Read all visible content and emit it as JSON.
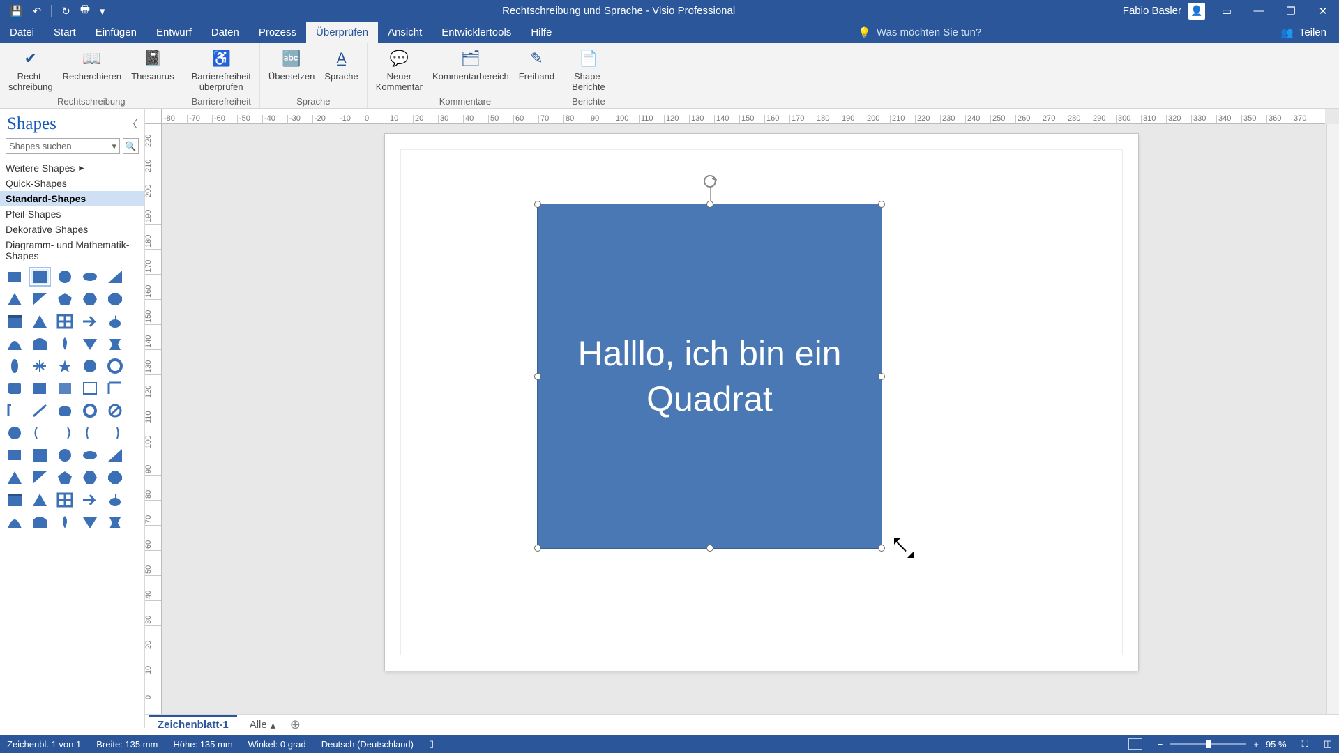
{
  "title": "Rechtschreibung und Sprache  -  Visio Professional",
  "user_name": "Fabio Basler",
  "qat": {
    "save": "💾",
    "undo": "↶",
    "redo": "↻",
    "print": "🖶"
  },
  "tabs": [
    "Datei",
    "Start",
    "Einfügen",
    "Entwurf",
    "Daten",
    "Prozess",
    "Überprüfen",
    "Ansicht",
    "Entwicklertools",
    "Hilfe"
  ],
  "active_tab_index": 6,
  "tell_me": "Was möchten Sie tun?",
  "share": "Teilen",
  "ribbon_groups": [
    {
      "label": "Rechtschreibung",
      "buttons": [
        {
          "id": "spelling",
          "label": "Recht-\nschreibung",
          "glyph": "✔"
        },
        {
          "id": "research",
          "label": "Recherchieren",
          "glyph": "📖"
        },
        {
          "id": "thesaurus",
          "label": "Thesaurus",
          "glyph": "📓"
        }
      ]
    },
    {
      "label": "Barrierefreiheit",
      "buttons": [
        {
          "id": "a11y",
          "label": "Barrierefreiheit\nüberprüfen",
          "glyph": "♿"
        }
      ]
    },
    {
      "label": "Sprache",
      "buttons": [
        {
          "id": "translate",
          "label": "Übersetzen",
          "glyph": "🔤"
        },
        {
          "id": "language",
          "label": "Sprache",
          "glyph": "A̲"
        }
      ]
    },
    {
      "label": "Kommentare",
      "buttons": [
        {
          "id": "newcomment",
          "label": "Neuer\nKommentar",
          "glyph": "💬"
        },
        {
          "id": "commentpane",
          "label": "Kommentarbereich",
          "glyph": "🗂"
        },
        {
          "id": "ink",
          "label": "Freihand",
          "glyph": "✎"
        }
      ]
    },
    {
      "label": "Berichte",
      "buttons": [
        {
          "id": "shapereport",
          "label": "Shape-\nBerichte",
          "glyph": "📄"
        }
      ]
    }
  ],
  "shapes_pane": {
    "title": "Shapes",
    "search_placeholder": "Shapes suchen",
    "categories": [
      {
        "label": "Weitere Shapes",
        "has_sub": true
      },
      {
        "label": "Quick-Shapes"
      },
      {
        "label": "Standard-Shapes",
        "selected": true
      },
      {
        "label": "Pfeil-Shapes"
      },
      {
        "label": "Dekorative Shapes"
      },
      {
        "label": "Diagramm- und Mathematik-Shapes"
      }
    ]
  },
  "canvas": {
    "shape_text": "Halllo, ich bin ein Quadrat"
  },
  "page_tabs": {
    "page": "Zeichenblatt-1",
    "all": "Alle"
  },
  "status": {
    "page_info": "Zeichenbl. 1 von 1",
    "width": "Breite: 135 mm",
    "height": "Höhe: 135 mm",
    "angle": "Winkel: 0 grad",
    "language": "Deutsch (Deutschland)",
    "zoom": "95 %"
  },
  "ruler_h": [
    "-80",
    "-70",
    "-60",
    "-50",
    "-40",
    "-30",
    "-20",
    "-10",
    "0",
    "10",
    "20",
    "30",
    "40",
    "50",
    "60",
    "70",
    "80",
    "90",
    "100",
    "110",
    "120",
    "130",
    "140",
    "150",
    "160",
    "170",
    "180",
    "190",
    "200",
    "210",
    "220",
    "230",
    "240",
    "250",
    "260",
    "270",
    "280",
    "290",
    "300",
    "310",
    "320",
    "330",
    "340",
    "350",
    "360",
    "370"
  ],
  "ruler_v": [
    "220",
    "210",
    "200",
    "190",
    "180",
    "170",
    "160",
    "150",
    "140",
    "130",
    "120",
    "110",
    "100",
    "90",
    "80",
    "70",
    "60",
    "50",
    "40",
    "30",
    "20",
    "10",
    "0"
  ]
}
